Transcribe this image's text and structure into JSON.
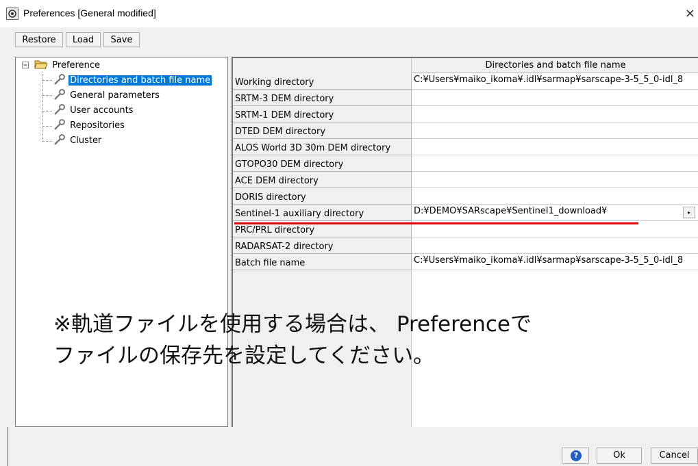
{
  "window": {
    "title": "Preferences [General modified]",
    "close_glyph": "×",
    "icon": "app-icon"
  },
  "toolbar": {
    "restore": "Restore",
    "load": "Load",
    "save": "Save"
  },
  "tree": {
    "root": "Preference",
    "items": [
      {
        "label": "Directories and batch file name",
        "selected": true
      },
      {
        "label": "General parameters",
        "selected": false
      },
      {
        "label": "User accounts",
        "selected": false
      },
      {
        "label": "Repositories",
        "selected": false
      },
      {
        "label": "Cluster",
        "selected": false
      }
    ]
  },
  "table": {
    "column_header": "Directories and batch file name",
    "rows": [
      {
        "label": "Working directory",
        "value": "C:¥Users¥maiko_ikoma¥.idl¥sarmap¥sarscape-3-5_5_0-idl_8"
      },
      {
        "label": "SRTM-3 DEM directory",
        "value": ""
      },
      {
        "label": "SRTM-1 DEM directory",
        "value": ""
      },
      {
        "label": "DTED DEM directory",
        "value": ""
      },
      {
        "label": "ALOS World 3D 30m DEM directory",
        "value": ""
      },
      {
        "label": "GTOPO30 DEM directory",
        "value": ""
      },
      {
        "label": "ACE DEM directory",
        "value": ""
      },
      {
        "label": "DORIS directory",
        "value": ""
      },
      {
        "label": "Sentinel-1 auxiliary directory",
        "value": "D:¥DEMO¥SARscape¥Sentinel1_download¥"
      },
      {
        "label": "PRC/PRL directory",
        "value": ""
      },
      {
        "label": "RADARSAT-2 directory",
        "value": ""
      },
      {
        "label": "Batch file name",
        "value": "C:¥Users¥maiko_ikoma¥.idl¥sarmap¥sarscape-3-5_5_0-idl_8"
      }
    ],
    "browse_glyph": "▸",
    "highlight_color": "#e00000"
  },
  "note": {
    "line1": "※軌道ファイルを使用する場合は、 Preferenceで",
    "line2": "ファイルの保存先を設定してください。"
  },
  "footer": {
    "help": "?",
    "ok": "Ok",
    "cancel": "Cancel"
  }
}
